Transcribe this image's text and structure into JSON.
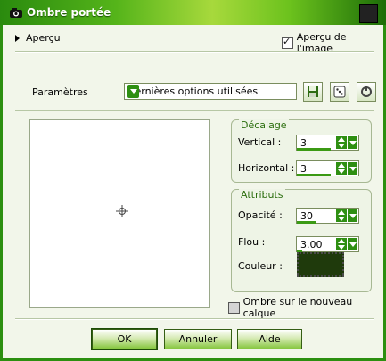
{
  "window": {
    "title": "Ombre portée"
  },
  "header": {
    "preview_toggle": "Aperçu",
    "image_preview_label": "Aperçu de l'image",
    "image_preview_checked": true
  },
  "params": {
    "label": "Paramètres",
    "preset_value": "Dernières options utilisées"
  },
  "offset": {
    "title": "Décalage",
    "vertical_label": "Vertical :",
    "vertical_value": "3",
    "horizontal_label": "Horizontal :",
    "horizontal_value": "3"
  },
  "attributes": {
    "title": "Attributs",
    "opacity_label": "Opacité :",
    "opacity_value": "30",
    "blur_label": "Flou :",
    "blur_value": "3.00",
    "color_label": "Couleur :",
    "color_value": "#1f3a0c"
  },
  "shadow_new_layer": {
    "label": "Ombre sur le nouveau calque",
    "checked": false
  },
  "buttons": {
    "ok": "OK",
    "cancel": "Annuler",
    "help": "Aide"
  }
}
